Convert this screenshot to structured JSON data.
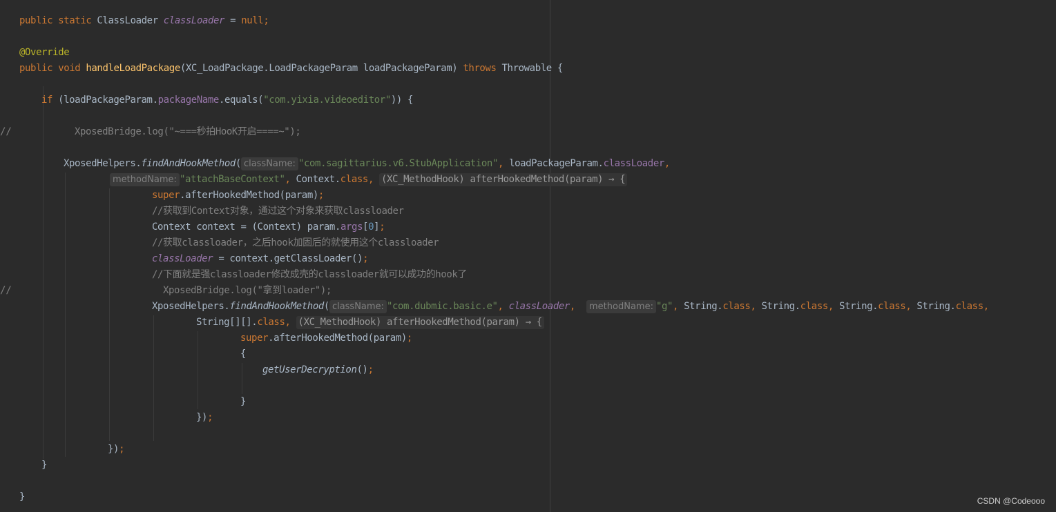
{
  "editor": {
    "watermark": "CSDN @Codeooo",
    "colors": {
      "background": "#2b2b2b",
      "default": "#a9b7c6",
      "keyword": "#cc7832",
      "string": "#6a8759",
      "field": "#9876aa",
      "method_decl": "#ffc66d",
      "annotation": "#bbb529",
      "comment": "#808080",
      "number": "#6897bb",
      "hint": "#808080"
    },
    "lines": [
      {
        "indent": 0,
        "segs": [
          {
            "t": "public static ",
            "c": "kw"
          },
          {
            "t": "ClassLoader "
          },
          {
            "t": "classLoader",
            "c": "field-it"
          },
          {
            "t": " = "
          },
          {
            "t": "null",
            "c": "kw"
          },
          {
            "t": ";",
            "c": "kw"
          }
        ]
      },
      {
        "indent": 0,
        "segs": []
      },
      {
        "indent": 0,
        "segs": [
          {
            "t": "@Override",
            "c": "anno"
          }
        ]
      },
      {
        "indent": 0,
        "segs": [
          {
            "t": "public void ",
            "c": "kw"
          },
          {
            "t": "handleLoadPackage",
            "c": "mdecl"
          },
          {
            "t": "(XC_LoadPackage.LoadPackageParam loadPackageParam) "
          },
          {
            "t": "throws ",
            "c": "kw"
          },
          {
            "t": "Throwable {"
          }
        ]
      },
      {
        "indent": 0,
        "segs": []
      },
      {
        "indent": 32,
        "segs": [
          {
            "t": "if ",
            "c": "kw"
          },
          {
            "t": "(loadPackageParam."
          },
          {
            "t": "packageName",
            "c": "field"
          },
          {
            "t": ".equals("
          },
          {
            "t": "\"com.yixia.videoeditor\"",
            "c": "str"
          },
          {
            "t": ")) {"
          }
        ]
      },
      {
        "indent": 0,
        "segs": []
      },
      {
        "indent": 80,
        "gutter": "//",
        "segs": [
          {
            "t": "XposedBridge.log(\"~===秒拍HooK开启====~\");",
            "c": "cmt"
          }
        ]
      },
      {
        "indent": 0,
        "segs": []
      },
      {
        "indent": 64,
        "segs": [
          {
            "t": "XposedHelpers."
          },
          {
            "t": "findAndHookMethod",
            "c": "it"
          },
          {
            "t": "("
          },
          {
            "t": "className:",
            "c": "hint"
          },
          {
            "t": "\"com.sagittarius.v6.StubApplication\"",
            "c": "str"
          },
          {
            "t": ", ",
            "c": "kw"
          },
          {
            "t": "loadPackageParam."
          },
          {
            "t": "classLoader",
            "c": "field"
          },
          {
            "t": ",",
            "c": "kw"
          }
        ]
      },
      {
        "indent": 131,
        "segs": [
          {
            "t": "methodName:",
            "c": "hint"
          },
          {
            "t": "\"attachBaseContext\"",
            "c": "str"
          },
          {
            "t": ", ",
            "c": "kw"
          },
          {
            "t": "Context."
          },
          {
            "t": "class",
            "c": "kw"
          },
          {
            "t": ", ",
            "c": "kw"
          },
          {
            "t": "(XC_MethodHook) afterHookedMethod(param) → {",
            "c": "lam"
          }
        ]
      },
      {
        "indent": 192,
        "segs": [
          {
            "t": "super",
            "c": "kw"
          },
          {
            "t": ".afterHookedMethod(param)"
          },
          {
            "t": ";",
            "c": "kw"
          }
        ]
      },
      {
        "indent": 192,
        "segs": [
          {
            "t": "//获取到Context对象，通过这个对象来获取classloader",
            "c": "cmt"
          }
        ]
      },
      {
        "indent": 192,
        "segs": [
          {
            "t": "Context context = (Context) param."
          },
          {
            "t": "args",
            "c": "field"
          },
          {
            "t": "["
          },
          {
            "t": "0",
            "c": "num"
          },
          {
            "t": "]"
          },
          {
            "t": ";",
            "c": "kw"
          }
        ]
      },
      {
        "indent": 192,
        "segs": [
          {
            "t": "//获取classloader，之后hook加固后的就使用这个classloader",
            "c": "cmt"
          }
        ]
      },
      {
        "indent": 192,
        "segs": [
          {
            "t": "classLoader",
            "c": "field-it"
          },
          {
            "t": " = context.getClassLoader()"
          },
          {
            "t": ";",
            "c": "kw"
          }
        ]
      },
      {
        "indent": 192,
        "segs": [
          {
            "t": "//下面就是强classloader修改成壳的classloader就可以成功的hook了",
            "c": "cmt"
          }
        ]
      },
      {
        "indent": 208,
        "gutter": "//",
        "segs": [
          {
            "t": "XposedBridge.log(\"拿到loader\");",
            "c": "cmt"
          }
        ]
      },
      {
        "indent": 192,
        "segs": [
          {
            "t": "XposedHelpers."
          },
          {
            "t": "findAndHookMethod",
            "c": "it"
          },
          {
            "t": "("
          },
          {
            "t": "className:",
            "c": "hint"
          },
          {
            "t": "\"com.dubmic.basic.e\"",
            "c": "str"
          },
          {
            "t": ", ",
            "c": "kw"
          },
          {
            "t": "classLoader",
            "c": "field-it"
          },
          {
            "t": ",  ",
            "c": "kw"
          },
          {
            "t": "methodName:",
            "c": "hint"
          },
          {
            "t": "\"g\"",
            "c": "str"
          },
          {
            "t": ", ",
            "c": "kw"
          },
          {
            "t": "String."
          },
          {
            "t": "class",
            "c": "kw"
          },
          {
            "t": ", ",
            "c": "kw"
          },
          {
            "t": "String."
          },
          {
            "t": "class",
            "c": "kw"
          },
          {
            "t": ", ",
            "c": "kw"
          },
          {
            "t": "String."
          },
          {
            "t": "class",
            "c": "kw"
          },
          {
            "t": ", ",
            "c": "kw"
          },
          {
            "t": "String."
          },
          {
            "t": "class",
            "c": "kw"
          },
          {
            "t": ",",
            "c": "kw"
          }
        ]
      },
      {
        "indent": 256,
        "segs": [
          {
            "t": "String[][]."
          },
          {
            "t": "class",
            "c": "kw"
          },
          {
            "t": ", ",
            "c": "kw"
          },
          {
            "t": "(XC_MethodHook) afterHookedMethod(param) → {",
            "c": "lam"
          }
        ]
      },
      {
        "indent": 320,
        "segs": [
          {
            "t": "super",
            "c": "kw"
          },
          {
            "t": ".afterHookedMethod(param)"
          },
          {
            "t": ";",
            "c": "kw"
          }
        ]
      },
      {
        "indent": 320,
        "segs": [
          {
            "t": "{"
          }
        ]
      },
      {
        "indent": 352,
        "segs": [
          {
            "t": "getUserDecryption",
            "c": "it"
          },
          {
            "t": "()"
          },
          {
            "t": ";",
            "c": "kw"
          }
        ]
      },
      {
        "indent": 0,
        "segs": []
      },
      {
        "indent": 320,
        "segs": [
          {
            "t": "}"
          }
        ]
      },
      {
        "indent": 256,
        "segs": [
          {
            "t": "})"
          },
          {
            "t": ";",
            "c": "kw"
          }
        ]
      },
      {
        "indent": 0,
        "segs": []
      },
      {
        "indent": 128,
        "segs": [
          {
            "t": "})"
          },
          {
            "t": ";",
            "c": "kw"
          }
        ]
      },
      {
        "indent": 32,
        "segs": [
          {
            "t": "}"
          }
        ]
      },
      {
        "indent": 0,
        "segs": []
      },
      {
        "indent": 0,
        "segs": [
          {
            "t": "}"
          }
        ]
      }
    ]
  }
}
